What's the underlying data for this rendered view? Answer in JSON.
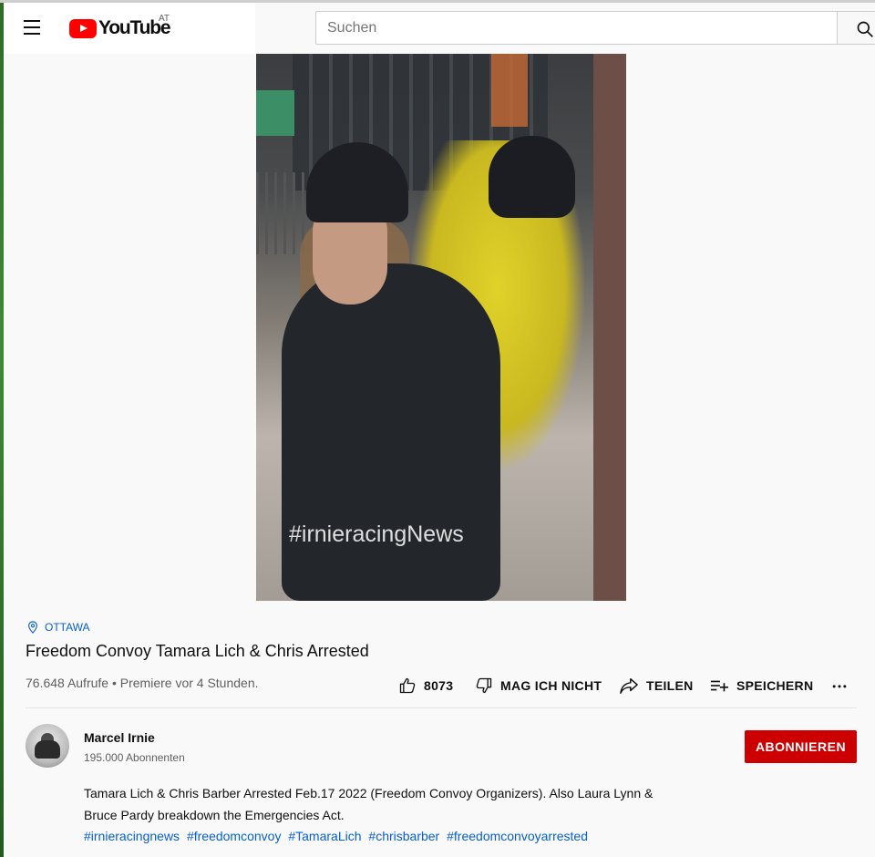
{
  "header": {
    "logo_text": "YouTube",
    "country_code": "AT",
    "search_placeholder": "Suchen"
  },
  "video": {
    "watermark": "#irnieracingNews"
  },
  "info": {
    "location": "OTTAWA",
    "title": "Freedom Convoy Tamara Lich & Chris Arrested",
    "meta": "76.648 Aufrufe • Premiere vor 4 Stunden."
  },
  "actions": {
    "like_count": "8073",
    "dislike_label": "MAG ICH NICHT",
    "share_label": "TEILEN",
    "save_label": "SPEICHERN"
  },
  "channel": {
    "name": "Marcel Irnie",
    "subscribers": "195.000 Abonnenten",
    "subscribe_label": "ABONNIEREN"
  },
  "description": {
    "text": "Tamara Lich & Chris Barber Arrested Feb.17 2022 (Freedom Convoy Organizers). Also Laura Lynn & Bruce Pardy breakdown the Emergencies Act.",
    "hashtags": [
      "#irnieracingnews",
      "#freedomconvoy",
      "#TamaraLich",
      "#chrisbarber",
      "#freedomconvoyarrested"
    ]
  },
  "colors": {
    "brand_red": "#ff0000",
    "subscribe_red": "#cc0000",
    "link_blue": "#065fd4"
  }
}
